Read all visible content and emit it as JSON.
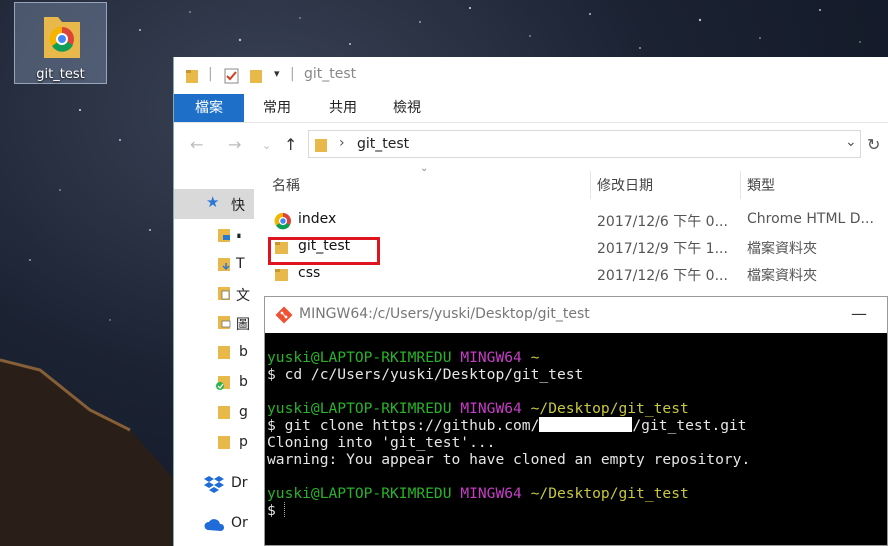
{
  "desktop": {
    "icon_label": "git_test"
  },
  "explorer": {
    "title": "git_test",
    "ribbon_tabs": [
      "檔案",
      "常用",
      "共用",
      "檢視"
    ],
    "address": "git_test",
    "columns": {
      "name": "名稱",
      "date": "修改日期",
      "type": "類型"
    },
    "sidebar": {
      "items": [
        {
          "label": "快",
          "icon": "star-icon"
        },
        {
          "label": "∎",
          "icon": "desktop-folder-icon"
        },
        {
          "label": "T",
          "icon": "download-folder-icon"
        },
        {
          "label": "文",
          "icon": "documents-folder-icon"
        },
        {
          "label": "圖",
          "icon": "pictures-folder-icon"
        },
        {
          "label": "b",
          "icon": "folder-icon"
        },
        {
          "label": "b",
          "icon": "folder-synced-icon"
        },
        {
          "label": "g",
          "icon": "folder-icon"
        },
        {
          "label": "p",
          "icon": "folder-icon"
        },
        {
          "label": "Dr",
          "icon": "dropbox-icon"
        },
        {
          "label": "Or",
          "icon": "onedrive-icon"
        }
      ]
    },
    "files": [
      {
        "name": "index",
        "date": "2017/12/6 下午 0...",
        "type": "Chrome HTML D...",
        "icon": "chrome-icon"
      },
      {
        "name": "git_test",
        "date": "2017/12/9 下午 1...",
        "type": "檔案資料夾",
        "icon": "folder-icon"
      },
      {
        "name": "css",
        "date": "2017/12/6 下午 0...",
        "type": "檔案資料夾",
        "icon": "folder-icon"
      }
    ]
  },
  "terminal": {
    "title": "MINGW64:/c/Users/yuski/Desktop/git_test",
    "lines": {
      "p1_user": "yuski@LAPTOP-RKIMREDU",
      "p1_env": "MINGW64",
      "p1_path": "~",
      "cmd1": "$ cd /c/Users/yuski/Desktop/git_test",
      "p2_user": "yuski@LAPTOP-RKIMREDU",
      "p2_env": "MINGW64",
      "p2_path": "~/Desktop/git_test",
      "cmd2_a": "$ git clone https://github.com/",
      "cmd2_b": "/git_test.git",
      "out1": "Cloning into 'git_test'...",
      "out2": "warning: You appear to have cloned an empty repository.",
      "p3_user": "yuski@LAPTOP-RKIMREDU",
      "p3_env": "MINGW64",
      "p3_path": "~/Desktop/git_test",
      "prompt": "$"
    }
  },
  "colors": {
    "ribbon_file_tab": "#1e6fc8",
    "highlight": "#e0141e",
    "prompt_user": "#28b428",
    "prompt_env": "#c83cc8",
    "prompt_path": "#c8c83c"
  }
}
